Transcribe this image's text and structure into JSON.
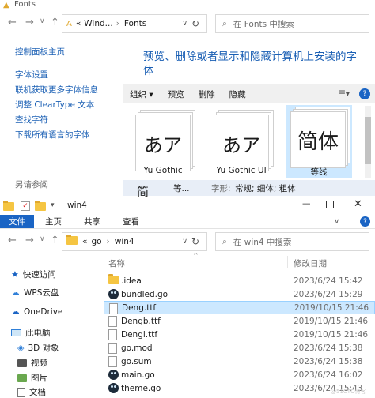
{
  "top_window": {
    "title": "Fonts",
    "breadcrumb": [
      "«",
      "Wind...",
      "›",
      "Fonts"
    ],
    "search_placeholder": "在 Fonts 中搜索",
    "sidebar_links": [
      "控制面板主页",
      "字体设置",
      "联机获取更多字体信息",
      "调整 ClearType 文本",
      "查找字符",
      "下载所有语言的字体"
    ],
    "see_also": "另请参阅",
    "heading": "预览、删除或者显示和隐藏计算机上安装的字体",
    "toolbar": [
      "组织 ▾",
      "预览",
      "删除",
      "隐藏"
    ],
    "fonts": [
      {
        "preview": "あア",
        "label": "Yu Gothic"
      },
      {
        "preview": "あア",
        "label": "Yu Gothic UI"
      },
      {
        "preview": "简体",
        "label": "等线"
      }
    ],
    "details": {
      "name": "等...",
      "style_label": "字形:",
      "style_value": "常规; 细体; 粗体"
    }
  },
  "bottom_window": {
    "title": "win4",
    "tabs": [
      "文件",
      "主页",
      "共享",
      "查看"
    ],
    "breadcrumb": [
      "go",
      "›",
      "win4"
    ],
    "search_placeholder": "在 win4 中搜索",
    "columns": {
      "name": "名称",
      "modified": "修改日期"
    },
    "nav": [
      "快速访问",
      "WPS云盘",
      "OneDrive",
      "此电脑",
      "3D 对象",
      "视频",
      "图片",
      "文档"
    ],
    "files": [
      {
        "name": ".idea",
        "date": "2023/6/24 15:42",
        "type": "folder"
      },
      {
        "name": "bundled.go",
        "date": "2023/6/24 15:29",
        "type": "go"
      },
      {
        "name": "Deng.ttf",
        "date": "2019/10/15 21:46",
        "type": "file"
      },
      {
        "name": "Dengb.ttf",
        "date": "2019/10/15 21:46",
        "type": "file"
      },
      {
        "name": "Dengl.ttf",
        "date": "2019/10/15 21:46",
        "type": "file"
      },
      {
        "name": "go.mod",
        "date": "2023/6/24 15:38",
        "type": "file"
      },
      {
        "name": "go.sum",
        "date": "2023/6/24 15:38",
        "type": "file"
      },
      {
        "name": "main.go",
        "date": "2023/6/24 16:02",
        "type": "go"
      },
      {
        "name": "theme.go",
        "date": "2023/6/24 15:43",
        "type": "go"
      }
    ],
    "watermark": "@51CTO博客"
  },
  "colors": {
    "accent": "#1a64c4",
    "selection": "#cce8ff",
    "link": "#1a5fb4"
  }
}
